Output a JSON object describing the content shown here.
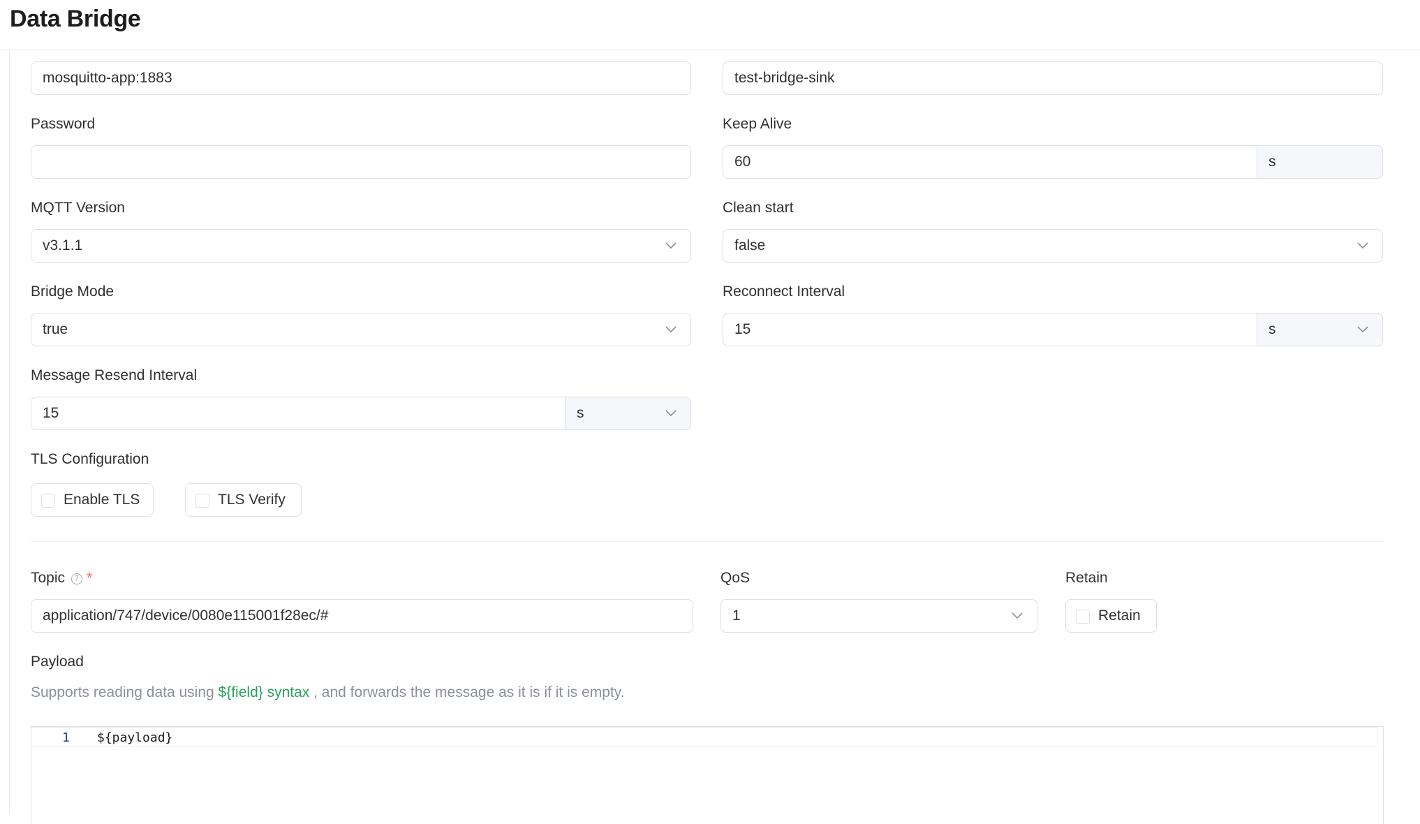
{
  "header": {
    "title": "Data Bridge"
  },
  "connection": {
    "server_value": "mosquitto-app:1883",
    "client_id_value": "test-bridge-sink",
    "password_label": "Password",
    "password_value": "",
    "keep_alive_label": "Keep Alive",
    "keep_alive_value": "60",
    "keep_alive_unit": "s",
    "mqtt_version_label": "MQTT Version",
    "mqtt_version_value": "v3.1.1",
    "clean_start_label": "Clean start",
    "clean_start_value": "false",
    "bridge_mode_label": "Bridge Mode",
    "bridge_mode_value": "true",
    "reconnect_interval_label": "Reconnect Interval",
    "reconnect_interval_value": "15",
    "reconnect_interval_unit": "s",
    "resend_interval_label": "Message Resend Interval",
    "resend_interval_value": "15",
    "resend_interval_unit": "s"
  },
  "tls": {
    "label": "TLS Configuration",
    "enable_tls_label": "Enable TLS",
    "enable_tls_checked": false,
    "tls_verify_label": "TLS Verify",
    "tls_verify_checked": false
  },
  "publish": {
    "topic_label": "Topic",
    "topic_required_mark": "*",
    "topic_help_icon": "question-circle-icon",
    "topic_value": "application/747/device/0080e115001f28ec/#",
    "qos_label": "QoS",
    "qos_value": "1",
    "retain_label": "Retain",
    "retain_checkbox_label": "Retain",
    "retain_checked": false
  },
  "payload": {
    "label": "Payload",
    "desc_prefix": "Supports reading data using ",
    "desc_link": "${field} syntax",
    "desc_suffix": " , and forwards the message as it is if it is empty.",
    "line_number": "1",
    "code": "${payload}"
  },
  "colors": {
    "link": "#29a35a",
    "required": "#f56c6c",
    "border": "#dcdfe6",
    "addon_bg": "#f5f7fa"
  }
}
